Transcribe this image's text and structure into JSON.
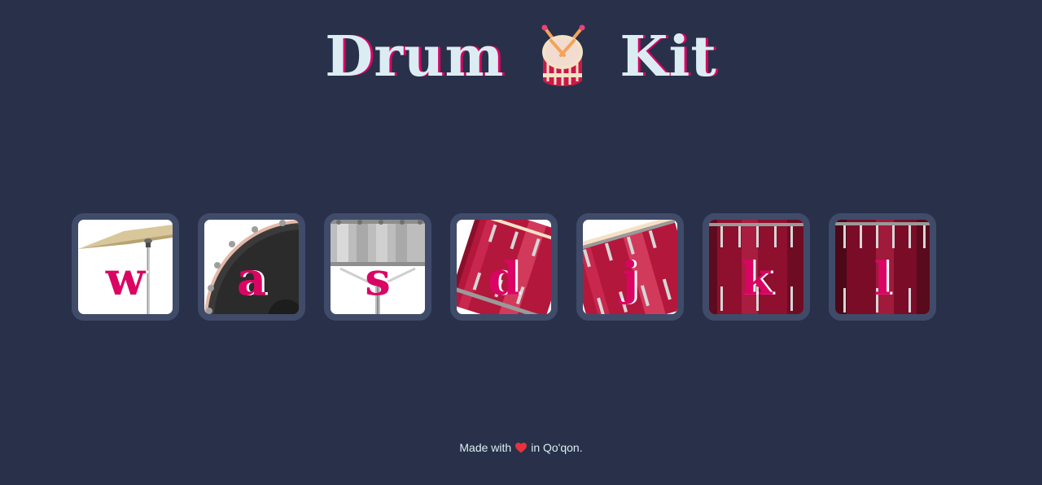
{
  "header": {
    "title_left": "Drum",
    "title_right": "Kit",
    "title_icon": "drum-with-sticks-icon",
    "colors": {
      "background": "#283149",
      "title_text": "#dbedf3",
      "title_shadow": "#da0463",
      "key_letter": "#da0463",
      "tile_border": "#404b69"
    }
  },
  "drums": [
    {
      "key": "w",
      "instrument": "crash-cymbal"
    },
    {
      "key": "a",
      "instrument": "kick-bass"
    },
    {
      "key": "s",
      "instrument": "snare"
    },
    {
      "key": "d",
      "instrument": "tom-1"
    },
    {
      "key": "j",
      "instrument": "tom-2"
    },
    {
      "key": "k",
      "instrument": "tom-3"
    },
    {
      "key": "l",
      "instrument": "tom-4"
    }
  ],
  "footer": {
    "prefix": "Made with",
    "icon": "heart-icon",
    "suffix": "in Qo'qon."
  }
}
